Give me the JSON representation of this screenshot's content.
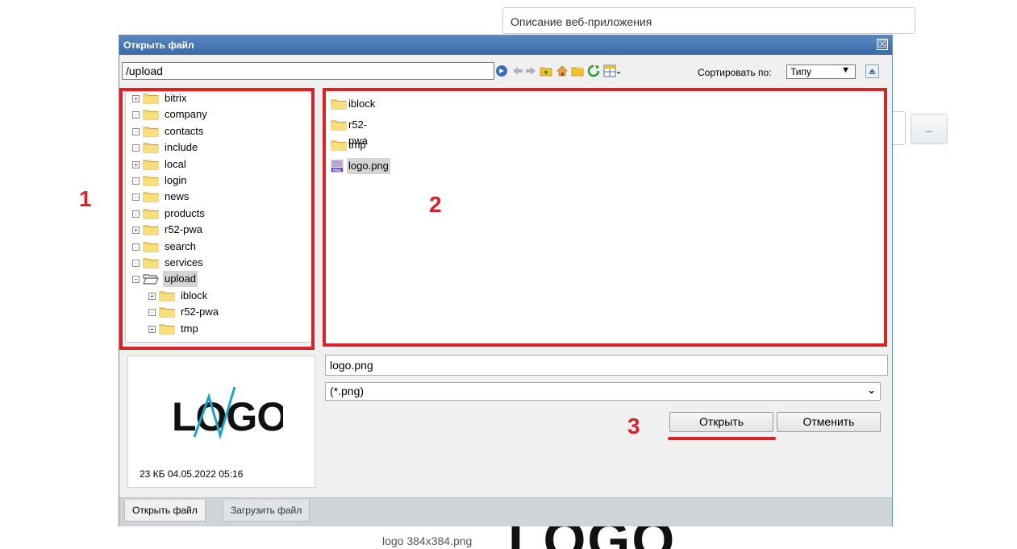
{
  "background": {
    "field_text": "Описание веб-приложения",
    "dots_button": "...",
    "caption": "logo 384x384.png",
    "big_logo": "LOGO"
  },
  "dialog": {
    "title": "Открыть файл",
    "close_glyph": "☒",
    "path": "/upload",
    "toolbar_icons": [
      "go-icon",
      "back-icon",
      "forward-icon",
      "folder-up-icon",
      "home-icon",
      "new-folder-icon",
      "refresh-icon",
      "view-mode-icon"
    ],
    "sort_label": "Сортировать по:",
    "sort_value": "Типу",
    "tree": [
      {
        "label": "bitrix",
        "toggle": "+",
        "depth": 0,
        "open": false,
        "selected": false
      },
      {
        "label": "company",
        "toggle": "·",
        "depth": 0,
        "open": false,
        "selected": false
      },
      {
        "label": "contacts",
        "toggle": "·",
        "depth": 0,
        "open": false,
        "selected": false
      },
      {
        "label": "include",
        "toggle": "·",
        "depth": 0,
        "open": false,
        "selected": false
      },
      {
        "label": "local",
        "toggle": "+",
        "depth": 0,
        "open": false,
        "selected": false
      },
      {
        "label": "login",
        "toggle": "·",
        "depth": 0,
        "open": false,
        "selected": false
      },
      {
        "label": "news",
        "toggle": "·",
        "depth": 0,
        "open": false,
        "selected": false
      },
      {
        "label": "products",
        "toggle": "·",
        "depth": 0,
        "open": false,
        "selected": false
      },
      {
        "label": "r52-pwa",
        "toggle": "+",
        "depth": 0,
        "open": false,
        "selected": false
      },
      {
        "label": "search",
        "toggle": "·",
        "depth": 0,
        "open": false,
        "selected": false
      },
      {
        "label": "services",
        "toggle": "·",
        "depth": 0,
        "open": false,
        "selected": false
      },
      {
        "label": "upload",
        "toggle": "−",
        "depth": 0,
        "open": true,
        "selected": true
      },
      {
        "label": "iblock",
        "toggle": "+",
        "depth": 1,
        "open": false,
        "selected": false
      },
      {
        "label": "r52-pwa",
        "toggle": "·",
        "depth": 1,
        "open": false,
        "selected": false
      },
      {
        "label": "tmp",
        "toggle": "+",
        "depth": 1,
        "open": false,
        "selected": false
      }
    ],
    "files": [
      {
        "label": "iblock",
        "kind": "folder",
        "selected": false
      },
      {
        "label": "r52-pwa",
        "kind": "folder",
        "selected": false
      },
      {
        "label": "tmp",
        "kind": "folder",
        "selected": false
      },
      {
        "label": "logo.png",
        "kind": "png",
        "selected": true
      }
    ],
    "preview_logo_text": "LOGO",
    "preview_info": "23 КБ 04.05.2022 05:16",
    "filename_value": "logo.png",
    "filter_value": "(*.png)",
    "open_button": "Открыть",
    "cancel_button": "Отменить",
    "tabs": [
      {
        "label": "Открыть файл",
        "active": true
      },
      {
        "label": "Загрузить файл",
        "active": false
      }
    ]
  },
  "annotations": {
    "n1": "1",
    "n2": "2",
    "n3": "3",
    "color": "#d8232a"
  }
}
